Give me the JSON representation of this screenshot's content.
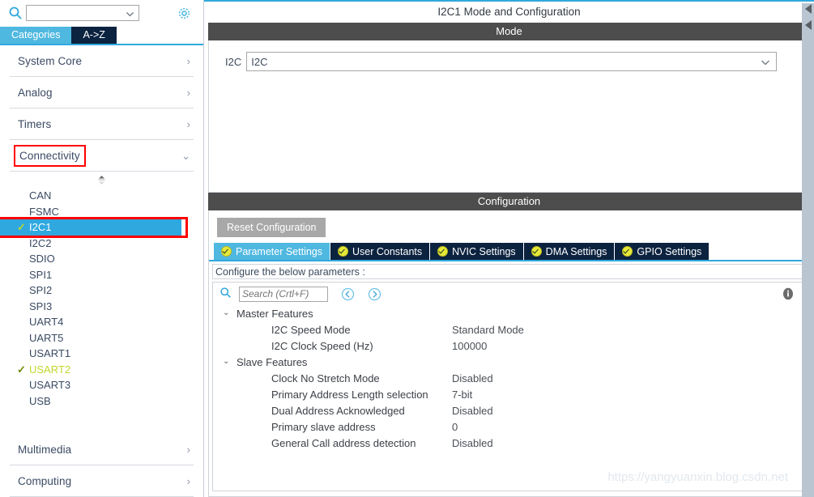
{
  "sidebar": {
    "search": {
      "value": "",
      "placeholder": ""
    },
    "search_icon": "search-icon",
    "gear_icon": "gear-icon",
    "tabs": [
      {
        "label": "Categories",
        "active": true
      },
      {
        "label": "A->Z",
        "active": false
      }
    ],
    "categories_top": [
      {
        "label": "System Core",
        "chevron": "›",
        "expanded": false,
        "highlighted": false
      },
      {
        "label": "Analog",
        "chevron": "›",
        "expanded": false,
        "highlighted": false
      },
      {
        "label": "Timers",
        "chevron": "›",
        "expanded": false,
        "highlighted": false
      },
      {
        "label": "Connectivity",
        "chevron": "⌄",
        "expanded": true,
        "highlighted": true
      }
    ],
    "peripherals": [
      {
        "label": "CAN",
        "state": "none"
      },
      {
        "label": "FSMC",
        "state": "none"
      },
      {
        "label": "I2C1",
        "state": "selected"
      },
      {
        "label": "I2C2",
        "state": "none"
      },
      {
        "label": "SDIO",
        "state": "none"
      },
      {
        "label": "SPI1",
        "state": "none"
      },
      {
        "label": "SPI2",
        "state": "none"
      },
      {
        "label": "SPI3",
        "state": "none"
      },
      {
        "label": "UART4",
        "state": "none"
      },
      {
        "label": "UART5",
        "state": "none"
      },
      {
        "label": "USART1",
        "state": "none"
      },
      {
        "label": "USART2",
        "state": "enabled"
      },
      {
        "label": "USART3",
        "state": "none"
      },
      {
        "label": "USB",
        "state": "none"
      }
    ],
    "categories_bottom": [
      {
        "label": "Multimedia",
        "chevron": "›"
      },
      {
        "label": "Computing",
        "chevron": "›"
      }
    ]
  },
  "main": {
    "title": "I2C1 Mode and Configuration",
    "mode_band": "Mode",
    "mode": {
      "label": "I2C",
      "value": "I2C"
    },
    "config_band": "Configuration",
    "reset_label": "Reset Configuration",
    "tabs": [
      {
        "label": "Parameter Settings",
        "active": true
      },
      {
        "label": "User Constants",
        "active": false
      },
      {
        "label": "NVIC Settings",
        "active": false
      },
      {
        "label": "DMA Settings",
        "active": false
      },
      {
        "label": "GPIO Settings",
        "active": false
      }
    ],
    "configure_note": "Configure the below parameters :",
    "param_search": {
      "value": "",
      "placeholder": "Search (Crtl+F)"
    },
    "nav_back_icon": "back-arrow-icon",
    "nav_forward_icon": "forward-arrow-icon",
    "info_icon": "info-icon",
    "groups": [
      {
        "title": "Master Features",
        "twisty": "⌄",
        "rows": [
          {
            "name": "I2C Speed Mode",
            "value": "Standard Mode"
          },
          {
            "name": "I2C Clock Speed (Hz)",
            "value": "100000"
          }
        ]
      },
      {
        "title": "Slave Features",
        "twisty": "⌄",
        "rows": [
          {
            "name": "Clock No Stretch Mode",
            "value": "Disabled"
          },
          {
            "name": "Primary Address Length selection",
            "value": "7-bit"
          },
          {
            "name": "Dual Address Acknowledged",
            "value": "Disabled"
          },
          {
            "name": "Primary slave address",
            "value": "0"
          },
          {
            "name": "General Call address detection",
            "value": "Disabled"
          }
        ]
      }
    ]
  },
  "watermark": "https://yangyuanxin.blog.csdn.net",
  "colors": {
    "accent_blue": "#30a8dd",
    "active_tab": "#4fb8e0",
    "inactive_tab": "#0c2340",
    "band_gray": "#4d4d4d",
    "highlight_red": "#ff0000",
    "enabled_green": "#c3d62b"
  }
}
